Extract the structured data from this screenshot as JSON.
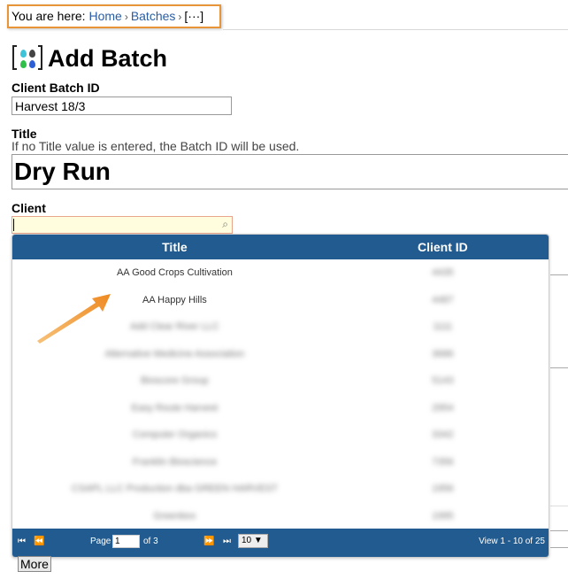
{
  "breadcrumb": {
    "prefix": "You are here:",
    "items": [
      "Home",
      "Batches"
    ],
    "current": "[···]",
    "separator": "›"
  },
  "page": {
    "title": "Add Batch",
    "logo_icon": "water-drops-icon"
  },
  "fields": {
    "batch_id": {
      "label": "Client Batch ID",
      "value": "Harvest 18/3"
    },
    "title": {
      "label": "Title",
      "hint": "If no Title value is entered, the Batch ID will be used.",
      "value": "Dry Run"
    },
    "client": {
      "label": "Client",
      "value": "",
      "icon": "search-icon"
    }
  },
  "grid": {
    "columns": [
      "Title",
      "Client ID"
    ],
    "rows": [
      {
        "title": "AA Good Crops Cultivation",
        "client_id": "4435",
        "blurred": false
      },
      {
        "title": "AA Happy Hills",
        "client_id": "4487",
        "blurred": false
      },
      {
        "title": "Add Clear River LLC",
        "client_id": "1111",
        "blurred": true
      },
      {
        "title": "Alternative Medicine Association",
        "client_id": "3686",
        "blurred": true
      },
      {
        "title": "Bioscore Group",
        "client_id": "5143",
        "blurred": true
      },
      {
        "title": "Easy Route Harvest",
        "client_id": "2954",
        "blurred": true
      },
      {
        "title": "Computer Organics",
        "client_id": "3342",
        "blurred": true
      },
      {
        "title": "Franklin Bioscience",
        "client_id": "7356",
        "blurred": true
      },
      {
        "title": "CSAPL LLC Production dba GREEN HARVEST",
        "client_id": "1956",
        "blurred": true
      },
      {
        "title": "Greenbox",
        "client_id": "1995",
        "blurred": true
      }
    ],
    "pager": {
      "page_label": "Page",
      "page": "1",
      "of_label": "of 3",
      "page_size": "10 ▼",
      "view_text": "View 1 - 10 of 25"
    }
  },
  "more_label": "More",
  "colors": {
    "header": "#215b8f",
    "highlight": "#e8953a",
    "link": "#2a5ea3"
  }
}
